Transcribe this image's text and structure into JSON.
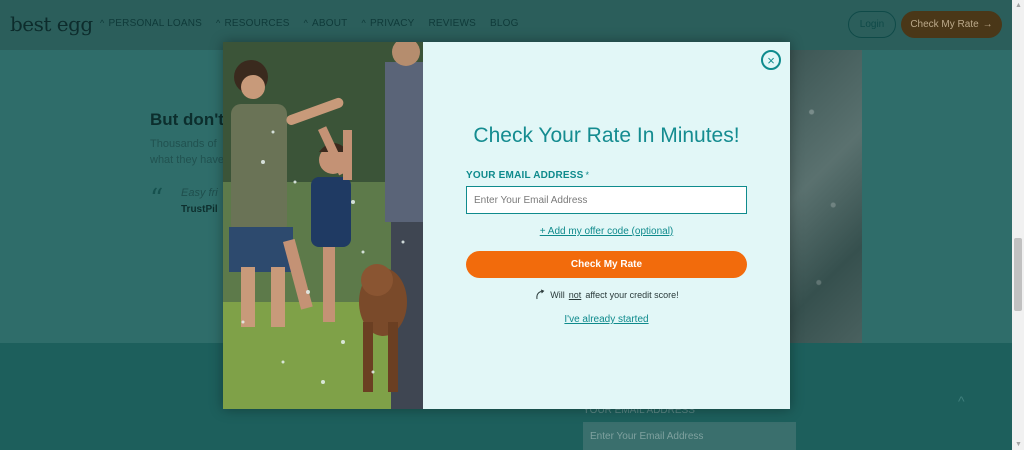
{
  "header": {
    "logo": "best egg",
    "nav": [
      {
        "label": "PERSONAL LOANS",
        "has_caret": true
      },
      {
        "label": "RESOURCES",
        "has_caret": true
      },
      {
        "label": "ABOUT",
        "has_caret": true
      },
      {
        "label": "PRIVACY",
        "has_caret": true
      },
      {
        "label": "REVIEWS",
        "has_caret": false
      },
      {
        "label": "BLOG",
        "has_caret": false
      }
    ],
    "login_label": "Login",
    "cta_label": "Check My Rate",
    "cta_arrow": "→"
  },
  "background": {
    "heading": "But don't",
    "para": "Thousands of what they have",
    "quote_mark": "“",
    "easy": "Easy fri",
    "trust": "TrustPil",
    "footer_email_label": "YOUR EMAIL ADDRESS",
    "footer_email_placeholder": "Enter Your Email Address",
    "chevron": "^"
  },
  "modal": {
    "close_icon": "×",
    "title": "Check Your Rate In Minutes!",
    "email_label": "YOUR EMAIL ADDRESS",
    "required_mark": "*",
    "email_placeholder": "Enter Your Email Address",
    "email_value": "",
    "offer_link": "+ Add my offer code (optional)",
    "cta_label": "Check My Rate",
    "credit_note_prefix": "Will",
    "credit_note_not": "not",
    "credit_note_suffix": "affect your credit score!",
    "started_link": "I've already started"
  },
  "colors": {
    "accent": "#0f8b8d",
    "cta": "#f26b0c",
    "modal_bg": "#e2f7f7",
    "overlay_page": "#2e6b68"
  },
  "icons": {
    "close": "close-icon",
    "curved_arrow": "curved-arrow-icon",
    "caret": "chevron-up-icon"
  }
}
